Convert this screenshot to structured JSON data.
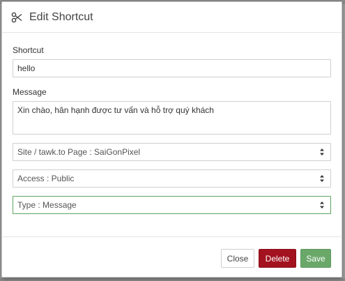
{
  "dialog": {
    "title": "Edit Shortcut",
    "icon": "scissors-icon"
  },
  "form": {
    "shortcut": {
      "label": "Shortcut",
      "value": "hello"
    },
    "message": {
      "label": "Message",
      "value": "Xin chào, hân hạnh được tư vấn và hỗ trợ quý khách"
    },
    "site_select": {
      "value": "Site / tawk.to Page : SaiGonPixel"
    },
    "access_select": {
      "value": "Access : Public"
    },
    "type_select": {
      "value": "Type : Message"
    }
  },
  "footer": {
    "close_label": "Close",
    "delete_label": "Delete",
    "save_label": "Save"
  },
  "colors": {
    "delete": "#a3121f",
    "save": "#6aa86a",
    "focus_border": "#5fa35f"
  }
}
